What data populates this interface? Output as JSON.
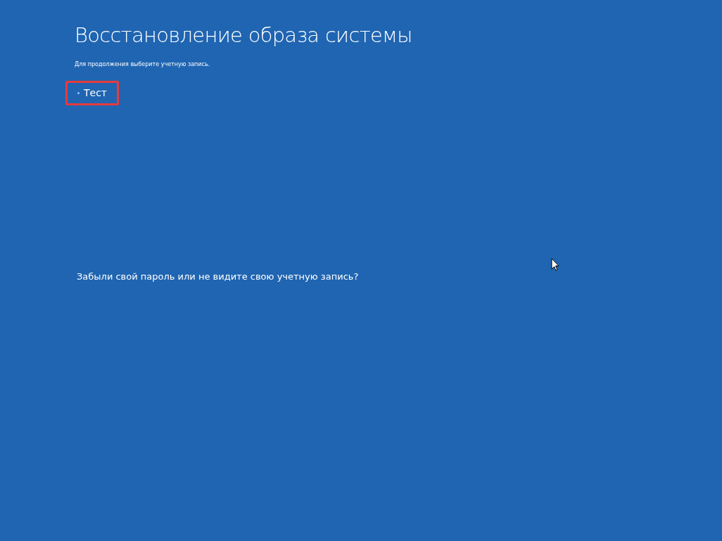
{
  "title": "Восстановление образа системы",
  "subtitle": "Для продолжения выберите учетную запись.",
  "accounts": [
    {
      "name": "Тест",
      "highlighted": true
    }
  ],
  "forgot_link": "Забыли свой пароль или не видите свою учетную запись?"
}
